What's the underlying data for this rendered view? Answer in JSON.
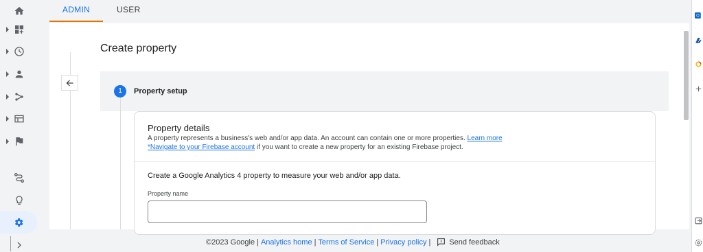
{
  "tabs": [
    {
      "label": "ADMIN"
    },
    {
      "label": "USER"
    }
  ],
  "rail_icons": [
    "home-icon",
    "dashboard-icon",
    "clock-icon",
    "person-icon",
    "flow-icon",
    "table-icon",
    "flag-icon",
    "path-icon",
    "lightbulb-icon",
    "settings-icon",
    "expand-icon"
  ],
  "page": {
    "title": "Create property",
    "step_number": "1",
    "step_label": "Property setup"
  },
  "details": {
    "title": "Property details",
    "desc": "A property represents a business's web and/or app data. An account can contain one or more properties.",
    "learn_more": "Learn more",
    "firebase_link": "*Navigate to your Firebase account",
    "firebase_suffix": " if you want to create a new property for an existing Firebase project.",
    "create_text": "Create a Google Analytics 4 property to measure your web and/or app data.",
    "field_label": "Property name",
    "field_value": ""
  },
  "footer": {
    "copyright": "©2023 Google",
    "analytics_home": "Analytics home",
    "terms": "Terms of Service",
    "privacy": "Privacy policy",
    "feedback": "Send feedback",
    "sep": "|"
  },
  "colors": {
    "accent": "#1a73e8",
    "tab_underline": "#e37400"
  }
}
